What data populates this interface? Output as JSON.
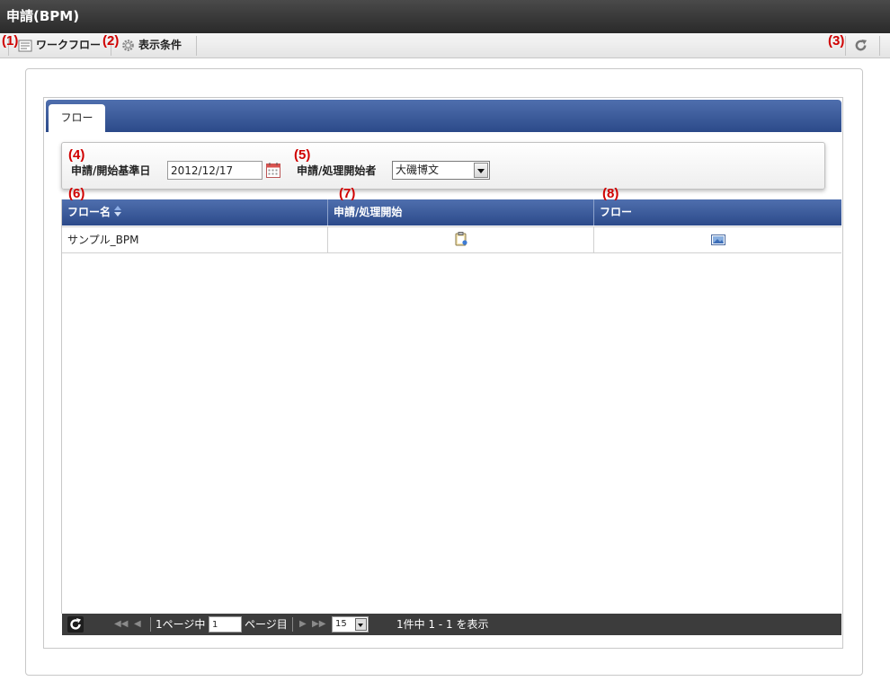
{
  "title": "申請(BPM)",
  "toolbar": {
    "workflow_label": "ワークフロー",
    "display_cond_label": "表示条件"
  },
  "annotations": [
    "(1)",
    "(2)",
    "(3)",
    "(4)",
    "(5)",
    "(6)",
    "(7)",
    "(8)"
  ],
  "tabs": [
    {
      "label": "フロー"
    }
  ],
  "conditions": {
    "date_label": "申請/開始基準日",
    "date_value": "2012/12/17",
    "starter_label": "申請/処理開始者",
    "starter_value": "大磯博文"
  },
  "grid": {
    "columns": [
      "フロー名",
      "申請/処理開始",
      "フロー"
    ],
    "rows": [
      {
        "flow_name": "サンプル_BPM"
      }
    ]
  },
  "pager": {
    "page_prefix": "1ページ中",
    "page_value": "1",
    "page_suffix": "ページ目",
    "page_size": "15",
    "summary": "1件中 1 - 1 を表示"
  }
}
